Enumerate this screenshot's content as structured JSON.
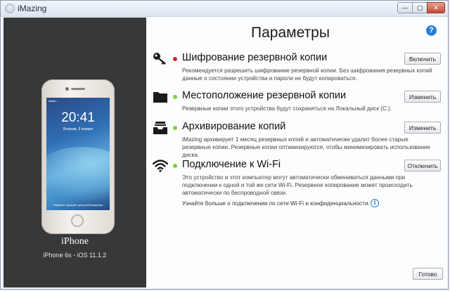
{
  "window": {
    "title": "iMazing"
  },
  "device": {
    "name": "iPhone",
    "model": "iPhone 6s - iOS 11.1.2",
    "lock_time": "20:41",
    "lock_date": "Вторник, 9 января",
    "carrier": "●●●●○",
    "unlock_text": "Нажмите «Домой» для разблокировки"
  },
  "page": {
    "title": "Параметры",
    "help": "?"
  },
  "sections": [
    {
      "icon": "key-icon",
      "status": "red",
      "title": "Шифрование резервной копии",
      "description": "Рекомендуется разрешить шифрование резервной копии. Без шифрования резервных копий данные о состоянии устройства и пароли не будут копироваться.",
      "button": "Включить"
    },
    {
      "icon": "folder-icon",
      "status": "green",
      "title": "Местоположение резервной копии",
      "description": "Резервные копии этого устройства будут сохраняться на Локальный диск (C:).",
      "button": "Изменить"
    },
    {
      "icon": "archive-tray-icon",
      "status": "green",
      "title": "Архивирование копий",
      "description": "iMazing архивирует 1 месяц резервных копий и автоматически удалит более старые резервные копии. Резервные копии оптимизируются, чтобы минимизировать использование диска.",
      "button": "Изменить"
    },
    {
      "icon": "wifi-icon",
      "status": "green",
      "title": "Подключение к Wi-Fi",
      "description": "Это устройство и этот компьютер могут автоматически обмениваться данными при подключении к одной и той же сети Wi-Fi. Резервное копирование может происходить автоматически по беспроводной связи.",
      "button": "Отключить",
      "link": "Узнайте больше о подключении по сети Wi-Fi и конфиденциальности."
    }
  ],
  "footer": {
    "done": "Готово"
  },
  "colors": {
    "status_red": "#d81f26",
    "status_green": "#7dd33c",
    "accent": "#2a7ed8",
    "sidebar": "#37383a"
  }
}
